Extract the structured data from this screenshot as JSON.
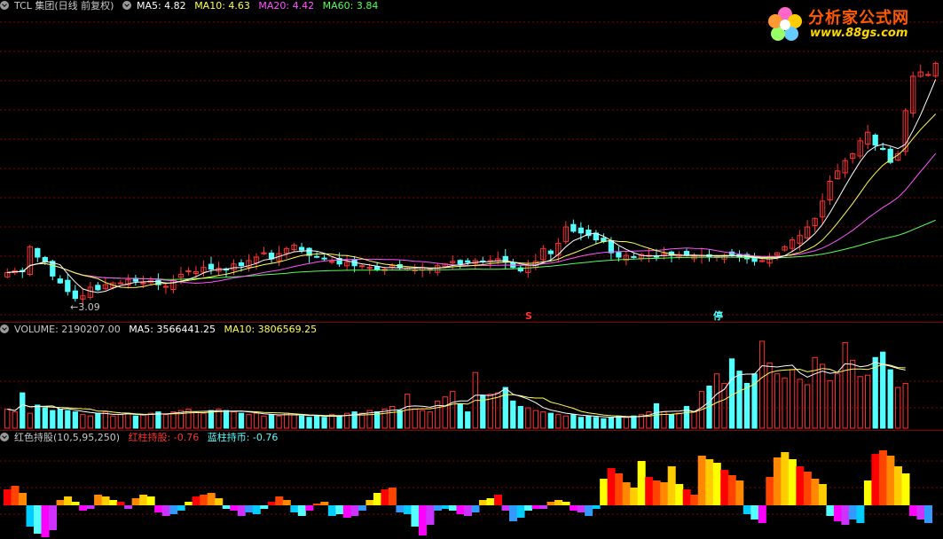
{
  "header": {
    "stock_title": "TCL 集团(日线 前复权)",
    "ma5": "MA5: 4.82",
    "ma10": "MA10: 4.63",
    "ma20": "MA20: 4.42",
    "ma60": "MA60: 3.84"
  },
  "volume_header": {
    "label": "VOLUME: 2190207.00",
    "ma5": "MA5: 3566441.25",
    "ma10": "MA10: 3806569.25"
  },
  "indicator_header": {
    "label": "红色持股(10,5,95,250)",
    "red": "红柱持股: -0.76",
    "blue": "蓝柱持币: -0.76"
  },
  "watermark": {
    "title": "分析家公式网",
    "url": "www.88gs.com"
  },
  "annotations": {
    "min_price": "3.09",
    "marker_s": "S",
    "marker_stop": "停"
  },
  "colors": {
    "up": "#ff3232",
    "down": "#54ffff",
    "ma5": "#ffffff",
    "ma10": "#ffff55",
    "ma20": "#ff55ff",
    "ma60": "#55ff55",
    "grid": "#8b0000"
  },
  "chart_data": {
    "type": "candlestick",
    "price_range": [
      2.9,
      6.4
    ],
    "closes": [
      3.42,
      3.44,
      3.43,
      3.72,
      3.6,
      3.55,
      3.38,
      3.3,
      3.2,
      3.12,
      3.15,
      3.25,
      3.22,
      3.28,
      3.3,
      3.3,
      3.34,
      3.32,
      3.3,
      3.33,
      3.28,
      3.26,
      3.33,
      3.4,
      3.44,
      3.43,
      3.48,
      3.46,
      3.47,
      3.45,
      3.52,
      3.5,
      3.56,
      3.6,
      3.65,
      3.58,
      3.64,
      3.7,
      3.74,
      3.68,
      3.62,
      3.6,
      3.58,
      3.55,
      3.52,
      3.54,
      3.5,
      3.5,
      3.48,
      3.45,
      3.46,
      3.5,
      3.48,
      3.47,
      3.45,
      3.48,
      3.46,
      3.5,
      3.52,
      3.55,
      3.52,
      3.54,
      3.56,
      3.55,
      3.56,
      3.58,
      3.54,
      3.48,
      3.44,
      3.5,
      3.55,
      3.7,
      3.64,
      3.76,
      3.95,
      3.9,
      3.88,
      3.85,
      3.8,
      3.78,
      3.65,
      3.6,
      3.62,
      3.6,
      3.63,
      3.62,
      3.6,
      3.64,
      3.62,
      3.63,
      3.62,
      3.61,
      3.62,
      3.6,
      3.61,
      3.62,
      3.63,
      3.6,
      3.58,
      3.55,
      3.56,
      3.6,
      3.65,
      3.72,
      3.8,
      3.85,
      3.95,
      4.05,
      4.25,
      4.48,
      4.6,
      4.72,
      4.8,
      4.95,
      5.05,
      4.9,
      4.85,
      4.7,
      4.8,
      5.3,
      5.7,
      5.75,
      5.72,
      5.85
    ],
    "volumes": [
      1.4,
      1.2,
      2.6,
      1.1,
      1.7,
      1.5,
      1.3,
      1.4,
      1.3,
      1.2,
      1.0,
      0.9,
      1.1,
      1.2,
      0.9,
      1.0,
      1.1,
      0.9,
      1.0,
      1.1,
      1.2,
      1.0,
      1.2,
      1.3,
      1.4,
      1.2,
      1.1,
      1.3,
      1.4,
      1.3,
      1.2,
      1.1,
      1.0,
      1.1,
      0.9,
      1.0,
      0.9,
      1.1,
      1.0,
      0.9,
      0.8,
      0.9,
      0.8,
      1.0,
      0.9,
      1.1,
      1.2,
      1.1,
      1.3,
      1.2,
      1.4,
      1.6,
      1.3,
      2.5,
      1.4,
      1.3,
      1.2,
      2.0,
      2.3,
      2.7,
      1.8,
      1.2,
      4.1,
      2.4,
      2.5,
      2.6,
      3.0,
      2.0,
      1.6,
      1.5,
      1.3,
      1.2,
      1.1,
      1.0,
      0.9,
      1.0,
      0.8,
      0.9,
      0.8,
      0.7,
      0.8,
      0.9,
      0.8,
      0.9,
      1.0,
      1.2,
      1.8,
      1.2,
      1.0,
      1.1,
      1.6,
      1.2,
      2.7,
      3.1,
      4.0,
      3.3,
      5.1,
      4.2,
      3.3,
      4.0,
      6.4,
      4.8,
      4.0,
      3.7,
      4.3,
      3.6,
      3.2,
      5.2,
      4.7,
      3.5,
      4.0,
      6.3,
      5.0,
      3.8,
      3.9,
      5.2,
      5.6,
      4.3,
      3.0,
      3.3
    ],
    "indicator": [
      0.9,
      1.1,
      0.7,
      -1.2,
      -1.6,
      -2.0,
      -1.4,
      0.3,
      0.5,
      0.2,
      -0.3,
      -0.2,
      0.6,
      0.5,
      0.3,
      0.2,
      -0.2,
      0.4,
      0.6,
      0.5,
      -0.4,
      -0.6,
      -0.5,
      -0.3,
      0.2,
      0.5,
      0.6,
      0.7,
      0.4,
      -0.2,
      -0.3,
      -0.6,
      -0.4,
      -0.5,
      -0.2,
      0.2,
      0.5,
      0.3,
      -0.4,
      -0.6,
      -0.3,
      0.1,
      0.2,
      -0.6,
      -0.5,
      -0.7,
      -0.6,
      -0.3,
      0.3,
      0.7,
      0.9,
      1.0,
      -0.4,
      -0.5,
      -1.2,
      -1.7,
      -1.1,
      -0.3,
      -0.2,
      -0.3,
      -0.5,
      -0.6,
      -0.4,
      0.3,
      0.4,
      0.6,
      -0.3,
      -0.9,
      -0.7,
      -0.3,
      -0.2,
      -0.2,
      0.2,
      0.3,
      0.2,
      -0.3,
      -0.4,
      -0.6,
      -0.2,
      1.5,
      2.1,
      1.8,
      1.3,
      1.0,
      2.5,
      1.6,
      1.4,
      1.3,
      2.2,
      1.2,
      0.9,
      0.6,
      2.8,
      2.6,
      2.4,
      2.0,
      1.7,
      1.4,
      -0.5,
      -0.8,
      -1.0,
      1.6,
      2.7,
      3.0,
      2.6,
      2.2,
      1.9,
      1.5,
      1.2,
      -0.6,
      -0.9,
      -1.1,
      -0.8,
      -1.0,
      1.4,
      2.9,
      3.1,
      2.8,
      2.2,
      1.8,
      -0.6,
      -0.8,
      -1.0
    ]
  }
}
